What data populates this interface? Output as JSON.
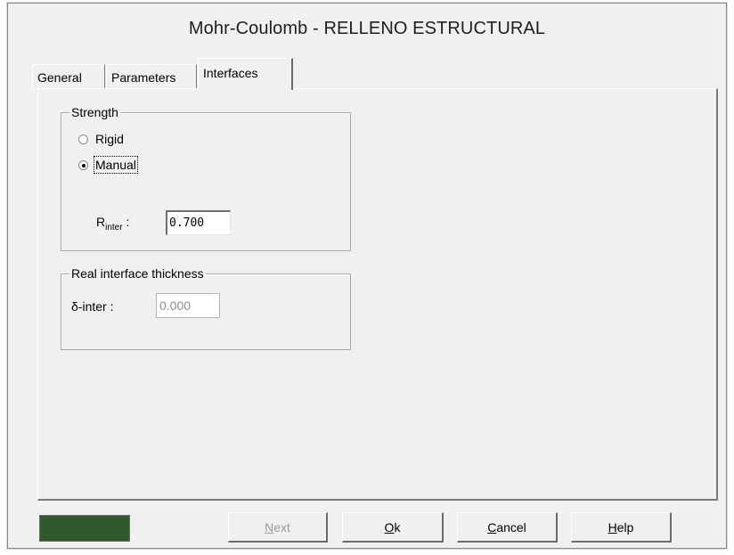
{
  "window": {
    "title": "Mohr-Coulomb - RELLENO ESTRUCTURAL"
  },
  "tabs": [
    {
      "label": "General",
      "selected": false
    },
    {
      "label": "Parameters",
      "selected": false
    },
    {
      "label": "Interfaces",
      "selected": true
    }
  ],
  "strength": {
    "legend": "Strength",
    "options": [
      {
        "label": "Rigid",
        "checked": false
      },
      {
        "label": "Manual",
        "checked": true
      }
    ],
    "rinter_label_main": "R",
    "rinter_label_sub": "inter",
    "rinter_label_suffix": " :",
    "rinter_value": "0.700"
  },
  "thickness": {
    "legend": "Real interface thickness",
    "delta_label": "δ-inter :",
    "delta_value": "0.000",
    "delta_enabled": false
  },
  "footer": {
    "swatch_color": "#2f5a2c",
    "buttons": [
      {
        "mnemonic": "N",
        "rest": "ext",
        "enabled": false
      },
      {
        "mnemonic": "O",
        "rest": "k",
        "enabled": true
      },
      {
        "mnemonic": "C",
        "rest": "ancel",
        "enabled": true
      },
      {
        "mnemonic": "H",
        "rest": "elp",
        "enabled": true
      }
    ]
  }
}
